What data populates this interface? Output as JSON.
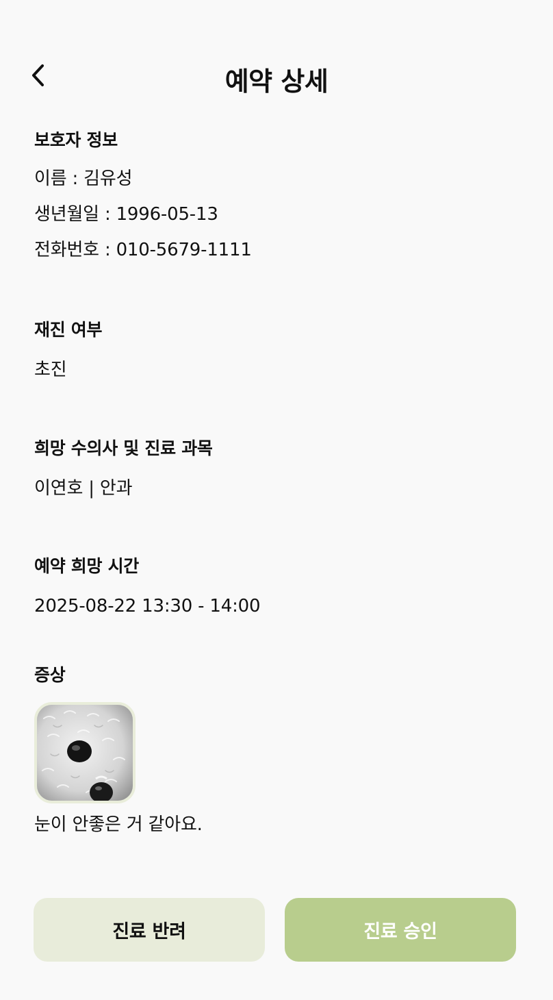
{
  "header": {
    "title": "예약 상세",
    "back_icon": "chevron-left-icon"
  },
  "guardian": {
    "title": "보호자 정보",
    "name": "이름 : 김유성",
    "birth": "생년월일 : 1996-05-13",
    "phone": "전화번호 : 010-5679-1111"
  },
  "revisit": {
    "title": "재진 여부",
    "value": "초진"
  },
  "vet": {
    "title": "희망 수의사 및 진료 과목",
    "value": "이연호 | 안과"
  },
  "schedule": {
    "title": "예약 희망 시간",
    "value": "2025-08-22 13:30 - 14:00"
  },
  "symptom": {
    "title": "증상",
    "description": "눈이 안좋은 거 같아요."
  },
  "actions": {
    "reject_label": "진료 반려",
    "approve_label": "진료 승인"
  },
  "colors": {
    "accent": "#b8cd8d",
    "reject_bg": "#e8ecda",
    "background": "#f9f9f9"
  }
}
